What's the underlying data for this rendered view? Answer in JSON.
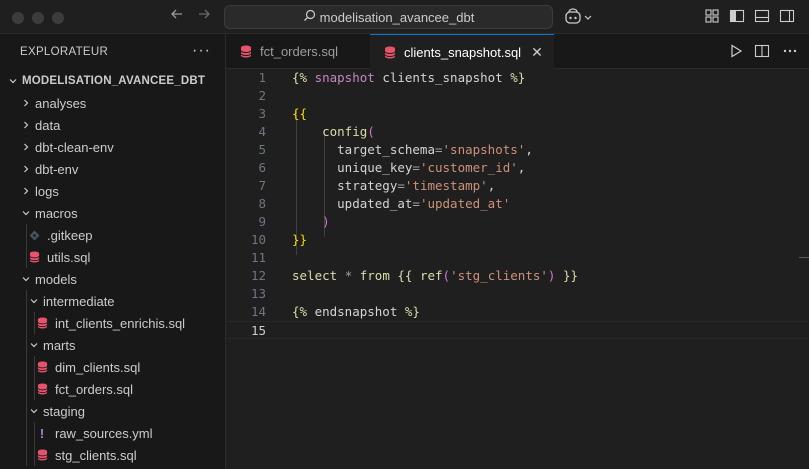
{
  "titlebar": {
    "search_text": "modelisation_avancee_dbt"
  },
  "sidebar": {
    "header": "EXPLORATEUR",
    "more": "···",
    "project": "MODELISATION_AVANCEE_DBT",
    "items": [
      {
        "label": "analyses",
        "type": "folder",
        "expanded": false,
        "depth": 0
      },
      {
        "label": "data",
        "type": "folder",
        "expanded": false,
        "depth": 0
      },
      {
        "label": "dbt-clean-env",
        "type": "folder",
        "expanded": false,
        "depth": 0
      },
      {
        "label": "dbt-env",
        "type": "folder",
        "expanded": false,
        "depth": 0
      },
      {
        "label": "logs",
        "type": "folder",
        "expanded": false,
        "depth": 0
      },
      {
        "label": "macros",
        "type": "folder",
        "expanded": true,
        "depth": 0
      },
      {
        "label": ".gitkeep",
        "type": "gitkeep",
        "depth": 1
      },
      {
        "label": "utils.sql",
        "type": "sql",
        "depth": 1
      },
      {
        "label": "models",
        "type": "folder",
        "expanded": true,
        "depth": 0
      },
      {
        "label": "intermediate",
        "type": "folder",
        "expanded": true,
        "depth": 1
      },
      {
        "label": "int_clients_enrichis.sql",
        "type": "sql",
        "depth": 2
      },
      {
        "label": "marts",
        "type": "folder",
        "expanded": true,
        "depth": 1
      },
      {
        "label": "dim_clients.sql",
        "type": "sql",
        "depth": 2
      },
      {
        "label": "fct_orders.sql",
        "type": "sql",
        "depth": 2
      },
      {
        "label": "staging",
        "type": "folder",
        "expanded": true,
        "depth": 1
      },
      {
        "label": "raw_sources.yml",
        "type": "yml",
        "depth": 2
      },
      {
        "label": "stg_clients.sql",
        "type": "sql",
        "depth": 2
      }
    ]
  },
  "tabs": [
    {
      "label": "fct_orders.sql",
      "active": false
    },
    {
      "label": "clients_snapshot.sql",
      "active": true,
      "close": "✕"
    }
  ],
  "editor": {
    "current_line": 15,
    "lines": [
      [
        [
          "{% ",
          "t-jinja"
        ],
        [
          "snapshot ",
          "t-kw"
        ],
        [
          "clients_snapshot ",
          "t-id"
        ],
        [
          "%}",
          "t-jinja"
        ]
      ],
      [],
      [
        [
          "{{",
          "t-brace1"
        ]
      ],
      [
        [
          "    ",
          "t-id"
        ],
        [
          "config",
          "t-fn"
        ],
        [
          "(",
          "t-brace2"
        ]
      ],
      [
        [
          "      target_schema",
          "t-id"
        ],
        [
          "=",
          "t-op"
        ],
        [
          "'snapshots'",
          "t-str"
        ],
        [
          ",",
          "t-punc"
        ]
      ],
      [
        [
          "      unique_key",
          "t-id"
        ],
        [
          "=",
          "t-op"
        ],
        [
          "'customer_id'",
          "t-str"
        ],
        [
          ",",
          "t-punc"
        ]
      ],
      [
        [
          "      strategy",
          "t-id"
        ],
        [
          "=",
          "t-op"
        ],
        [
          "'timestamp'",
          "t-str"
        ],
        [
          ",",
          "t-punc"
        ]
      ],
      [
        [
          "      updated_at",
          "t-id"
        ],
        [
          "=",
          "t-op"
        ],
        [
          "'updated_at'",
          "t-str"
        ]
      ],
      [
        [
          "    ",
          "t-id"
        ],
        [
          ")",
          "t-brace2"
        ]
      ],
      [
        [
          "}}",
          "t-brace1"
        ]
      ],
      [],
      [
        [
          "select ",
          "t-sqlkw"
        ],
        [
          "* ",
          "t-op"
        ],
        [
          "from ",
          "t-sqlkw"
        ],
        [
          "{{ ",
          "t-jinja"
        ],
        [
          "ref",
          "t-fn"
        ],
        [
          "(",
          "t-brace2"
        ],
        [
          "'stg_clients'",
          "t-str"
        ],
        [
          ")",
          "t-brace2"
        ],
        [
          " }}",
          "t-jinja"
        ]
      ],
      [],
      [
        [
          "{% ",
          "t-jinja"
        ],
        [
          "endsnapshot ",
          "t-id"
        ],
        [
          "%}",
          "t-jinja"
        ]
      ],
      []
    ]
  },
  "colors": {
    "sql_icon": "#e8536b",
    "yml_icon": "#b180d7",
    "accent": "#0078d4"
  }
}
